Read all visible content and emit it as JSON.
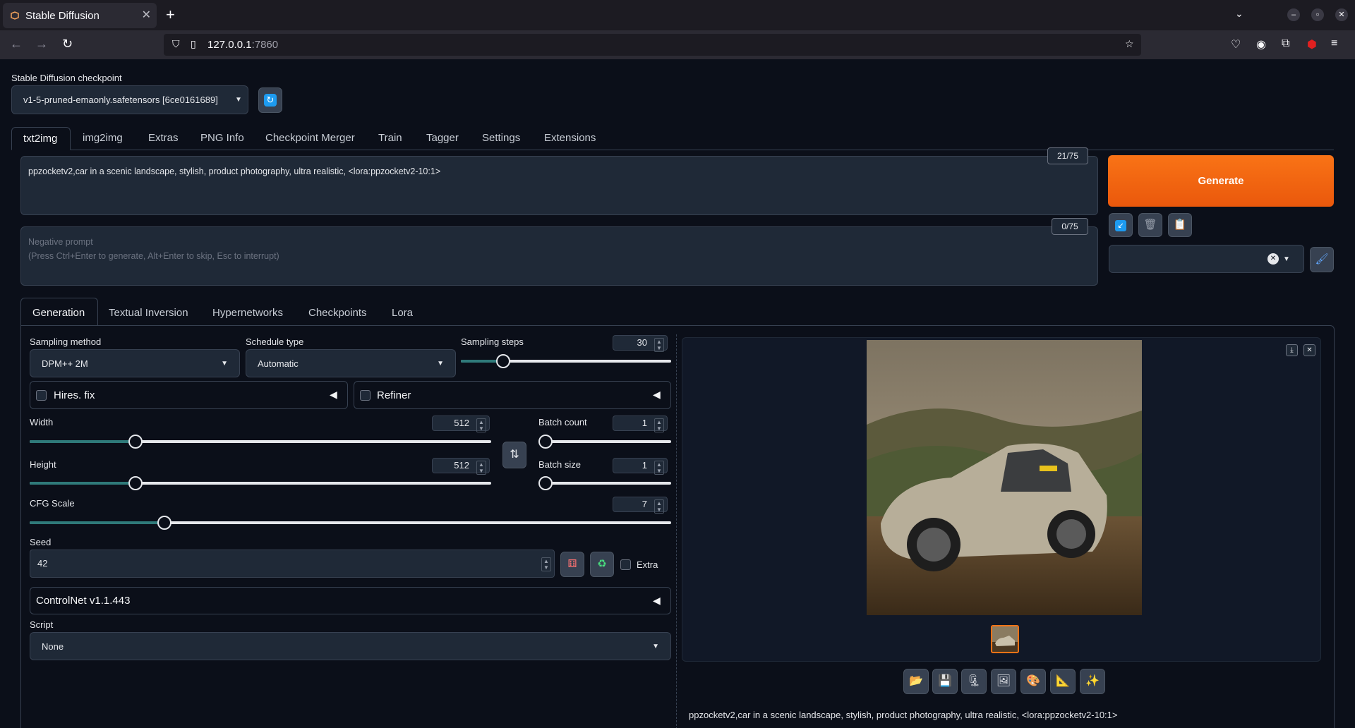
{
  "browser": {
    "tab_title": "Stable Diffusion",
    "url_host": "127.0.0.1",
    "url_port": ":7860"
  },
  "checkpoint": {
    "label": "Stable Diffusion checkpoint",
    "value": "v1-5-pruned-emaonly.safetensors [6ce0161689]"
  },
  "main_tabs": [
    "txt2img",
    "img2img",
    "Extras",
    "PNG Info",
    "Checkpoint Merger",
    "Train",
    "Tagger",
    "Settings",
    "Extensions"
  ],
  "prompt": {
    "text": "ppzocketv2,car in a scenic landscape, stylish, product photography, ultra realistic, <lora:ppzocketv2-10:1>",
    "counter": "21/75"
  },
  "negative_prompt": {
    "placeholder_line1": "Negative prompt",
    "placeholder_line2": "(Press Ctrl+Enter to generate, Alt+Enter to skip, Esc to interrupt)",
    "counter": "0/75"
  },
  "generate_label": "Generate",
  "sub_tabs": [
    "Generation",
    "Textual Inversion",
    "Hypernetworks",
    "Checkpoints",
    "Lora"
  ],
  "sampling_method": {
    "label": "Sampling method",
    "value": "DPM++ 2M"
  },
  "schedule_type": {
    "label": "Schedule type",
    "value": "Automatic"
  },
  "sampling_steps": {
    "label": "Sampling steps",
    "value": "30",
    "fraction": 0.2
  },
  "hires_fix": {
    "label": "Hires. fix"
  },
  "refiner": {
    "label": "Refiner"
  },
  "width": {
    "label": "Width",
    "value": "512",
    "fraction": 0.23
  },
  "height": {
    "label": "Height",
    "value": "512",
    "fraction": 0.23
  },
  "batch_count": {
    "label": "Batch count",
    "value": "1",
    "fraction": 0.0
  },
  "batch_size": {
    "label": "Batch size",
    "value": "1",
    "fraction": 0.0
  },
  "cfg_scale": {
    "label": "CFG Scale",
    "value": "7",
    "fraction": 0.21
  },
  "seed": {
    "label": "Seed",
    "value": "42",
    "extra_label": "Extra"
  },
  "controlnet": {
    "label": "ControlNet v1.1.443"
  },
  "script": {
    "label": "Script",
    "value": "None"
  },
  "output_caption": "ppzocketv2,car in a scenic landscape, stylish, product photography, ultra realistic, <lora:ppzocketv2-10:1>",
  "colors": {
    "accent": "#f97316",
    "background": "#0b0f19",
    "slider_fill": "#2f7a7a"
  }
}
